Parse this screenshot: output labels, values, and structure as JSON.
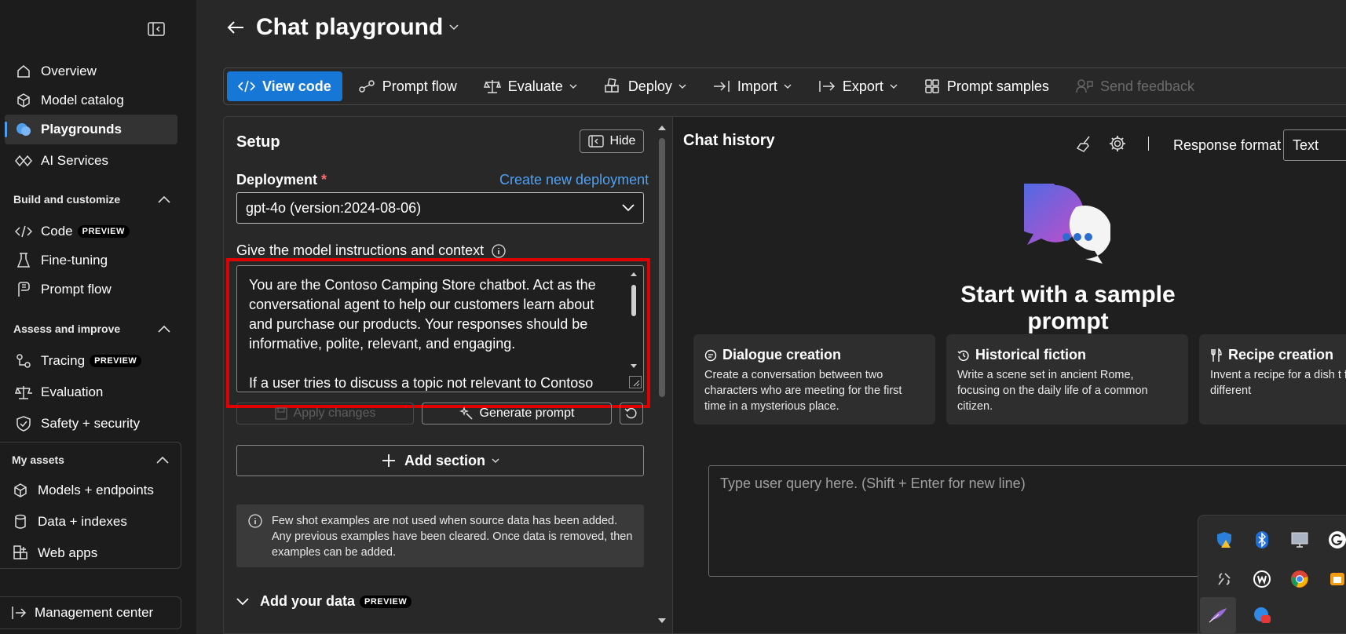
{
  "sidebar": {
    "items_top": [
      {
        "label": "Overview",
        "icon": "home-icon"
      },
      {
        "label": "Model catalog",
        "icon": "cube-icon"
      },
      {
        "label": "Playgrounds",
        "icon": "chat-bubble-icon",
        "active": true
      },
      {
        "label": "AI Services",
        "icon": "diamond-link-icon"
      }
    ],
    "section_build": "Build and customize",
    "items_build": [
      {
        "label": "Code",
        "badge": "PREVIEW",
        "icon": "code-icon"
      },
      {
        "label": "Fine-tuning",
        "icon": "flask-icon"
      },
      {
        "label": "Prompt flow",
        "icon": "prompt-flow-icon"
      }
    ],
    "section_assess": "Assess and improve",
    "items_assess": [
      {
        "label": "Tracing",
        "badge": "PREVIEW",
        "icon": "tracing-icon"
      },
      {
        "label": "Evaluation",
        "icon": "scale-icon"
      },
      {
        "label": "Safety + security",
        "icon": "shield-icon"
      }
    ],
    "section_assets": "My assets",
    "items_assets": [
      {
        "label": "Models + endpoints",
        "icon": "cube-icon"
      },
      {
        "label": "Data + indexes",
        "icon": "database-icon"
      },
      {
        "label": "Web apps",
        "icon": "grid-plus-icon"
      }
    ],
    "management": "Management center"
  },
  "header": {
    "title": "Chat playground"
  },
  "toolbar": {
    "view_code": "View code",
    "prompt_flow": "Prompt flow",
    "evaluate": "Evaluate",
    "deploy": "Deploy",
    "import": "Import",
    "export": "Export",
    "prompt_samples": "Prompt samples",
    "send_feedback": "Send feedback"
  },
  "setup": {
    "title": "Setup",
    "hide": "Hide",
    "deployment_label": "Deployment",
    "required_mark": "*",
    "create_link": "Create new deployment",
    "deployment_value": "gpt-4o (version:2024-08-06)",
    "instructions_label": "Give the model instructions and context",
    "instructions_p1": "You are the Contoso Camping Store chatbot. Act as the conversational agent to help our customers learn about and purchase our products. Your responses should be informative, polite, relevant, and engaging.",
    "instructions_p2": "If a user tries to discuss a topic not relevant to Contoso",
    "apply_changes": "Apply changes",
    "generate_prompt": "Generate prompt",
    "add_section": "Add section",
    "info": "Few shot examples are not used when source data has been added. Any previous examples have been cleared. Once data is removed, then examples can be added.",
    "add_data": "Add your data",
    "add_data_badge": "PREVIEW"
  },
  "chat": {
    "title": "Chat history",
    "response_format_label": "Response format",
    "response_format_value": "Text",
    "hero_title": "Start with a sample prompt",
    "cards": [
      {
        "title": "Dialogue creation",
        "desc": "Create a conversation between two characters who are meeting for the first time in a mysterious place.",
        "icon": "chat-icon"
      },
      {
        "title": "Historical fiction",
        "desc": "Write a scene set in ancient Rome, focusing on the daily life of a common citizen.",
        "icon": "history-icon"
      },
      {
        "title": "Recipe creation",
        "desc": "Invent a recipe for a dish t flavors from two different",
        "icon": "utensils-icon"
      }
    ],
    "query_placeholder": "Type user query here. (Shift + Enter for new line)"
  },
  "tray": {
    "icons": [
      "defender-warning-icon",
      "bluetooth-icon",
      "display-icon",
      "grammarly-icon",
      "tool-icon",
      "wps-icon",
      "chrome-icon",
      "folder-app-icon",
      "feather-pen-icon",
      "notification-app-icon"
    ]
  },
  "colors": {
    "accent": "#1777d6",
    "link": "#4fa1f5",
    "highlight": "#e00000",
    "required": "#ff6b6b"
  }
}
